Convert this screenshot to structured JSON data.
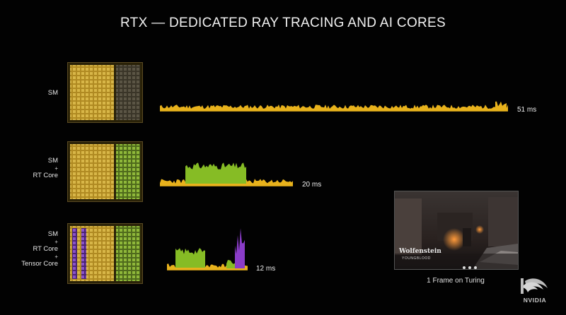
{
  "slide": {
    "title": "RTX — DEDICATED RAY TRACING AND AI CORES"
  },
  "rows": [
    {
      "id": "sm",
      "label_lines": [
        "SM"
      ],
      "time": "51 ms",
      "color": "#e8b21c"
    },
    {
      "id": "sm-rt",
      "label_lines": [
        "SM",
        "+",
        "RT Core"
      ],
      "time": "20 ms",
      "color": "#e8b21c",
      "accent": "#86bc25"
    },
    {
      "id": "sm-rt-tensor",
      "label_lines": [
        "SM",
        "+",
        "RT Core",
        "+",
        "Tensor Core"
      ],
      "time": "12 ms",
      "color": "#e8b21c",
      "accent": "#86bc25",
      "accent2": "#8a3cc8"
    }
  ],
  "colors": {
    "sm_trace": "#e8b21c",
    "rt_trace": "#86bc25",
    "tensor_trace": "#8a3cc8",
    "chip_gold": "#c9a53a",
    "chip_green": "#7fa532",
    "chip_purple": "#7b3fb8"
  },
  "game": {
    "logo_text": "Wolfenstein",
    "logo_sub": "YOUNGBLOOD",
    "caption": "1 Frame on Turing"
  },
  "brand": {
    "name": "NVIDIA"
  }
}
